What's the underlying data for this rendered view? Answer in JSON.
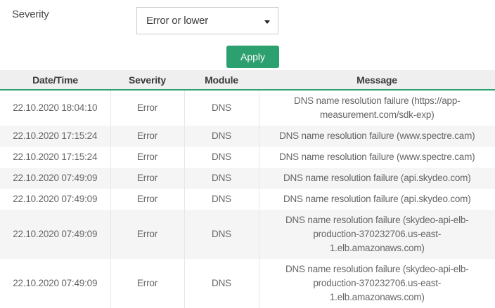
{
  "filter": {
    "severity_label": "Severity",
    "severity_selected": "Error or lower",
    "apply_label": "Apply"
  },
  "table": {
    "columns": [
      "Date/Time",
      "Severity",
      "Module",
      "Message"
    ],
    "rows": [
      {
        "datetime": "22.10.2020 18:04:10",
        "severity": "Error",
        "module": "DNS",
        "message": "DNS name resolution failure (https://app-measurement.com/sdk-exp)"
      },
      {
        "datetime": "22.10.2020 17:15:24",
        "severity": "Error",
        "module": "DNS",
        "message": "DNS name resolution failure (www.spectre.cam)"
      },
      {
        "datetime": "22.10.2020 17:15:24",
        "severity": "Error",
        "module": "DNS",
        "message": "DNS name resolution failure (www.spectre.cam)"
      },
      {
        "datetime": "22.10.2020 07:49:09",
        "severity": "Error",
        "module": "DNS",
        "message": "DNS name resolution failure (api.skydeo.com)"
      },
      {
        "datetime": "22.10.2020 07:49:09",
        "severity": "Error",
        "module": "DNS",
        "message": "DNS name resolution failure (api.skydeo.com)"
      },
      {
        "datetime": "22.10.2020 07:49:09",
        "severity": "Error",
        "module": "DNS",
        "message": "DNS name resolution failure (skydeo-api-elb-production-370232706.us-east-1.elb.amazonaws.com)"
      },
      {
        "datetime": "22.10.2020 07:49:09",
        "severity": "Error",
        "module": "DNS",
        "message": "DNS name resolution failure (skydeo-api-elb-production-370232706.us-east-1.elb.amazonaws.com)"
      }
    ]
  },
  "icons": {
    "select_caret": "chevron-down-icon"
  },
  "colors": {
    "accent_green": "#2da06f",
    "header_bg": "#efefef",
    "stripe_bg": "#f5f5f5",
    "body_text": "#666666",
    "divider": "#e7e7e7"
  }
}
